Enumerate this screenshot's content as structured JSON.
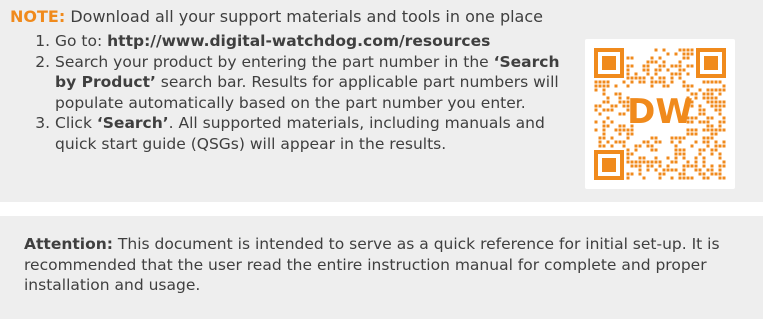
{
  "note": {
    "label": "NOTE:",
    "text": "Download all your support materials and tools in one place"
  },
  "steps": [
    {
      "number": "1.",
      "prefix": "Go to: ",
      "bold": "http://www.digital-watchdog.com/resources",
      "suffix": ""
    },
    {
      "number": "2.",
      "prefix": "Search your product by entering the part number in the ",
      "bold": "‘Search by Product’",
      "suffix": " search bar. Results for applicable part numbers will populate automatically based on the part number you enter."
    },
    {
      "number": "3.",
      "prefix": "Click ",
      "bold": "‘Search’",
      "suffix": ". All supported materials, including manuals and quick start guide (QSGs) will appear in the results."
    }
  ],
  "qr": {
    "logo_text": "DW",
    "color": "#f08a1c"
  },
  "attention": {
    "label": "Attention:",
    "text": "This document is intended to serve as a quick reference for initial set-up. It is recommended that the user read the entire instruction manual for complete and proper installation and usage."
  }
}
